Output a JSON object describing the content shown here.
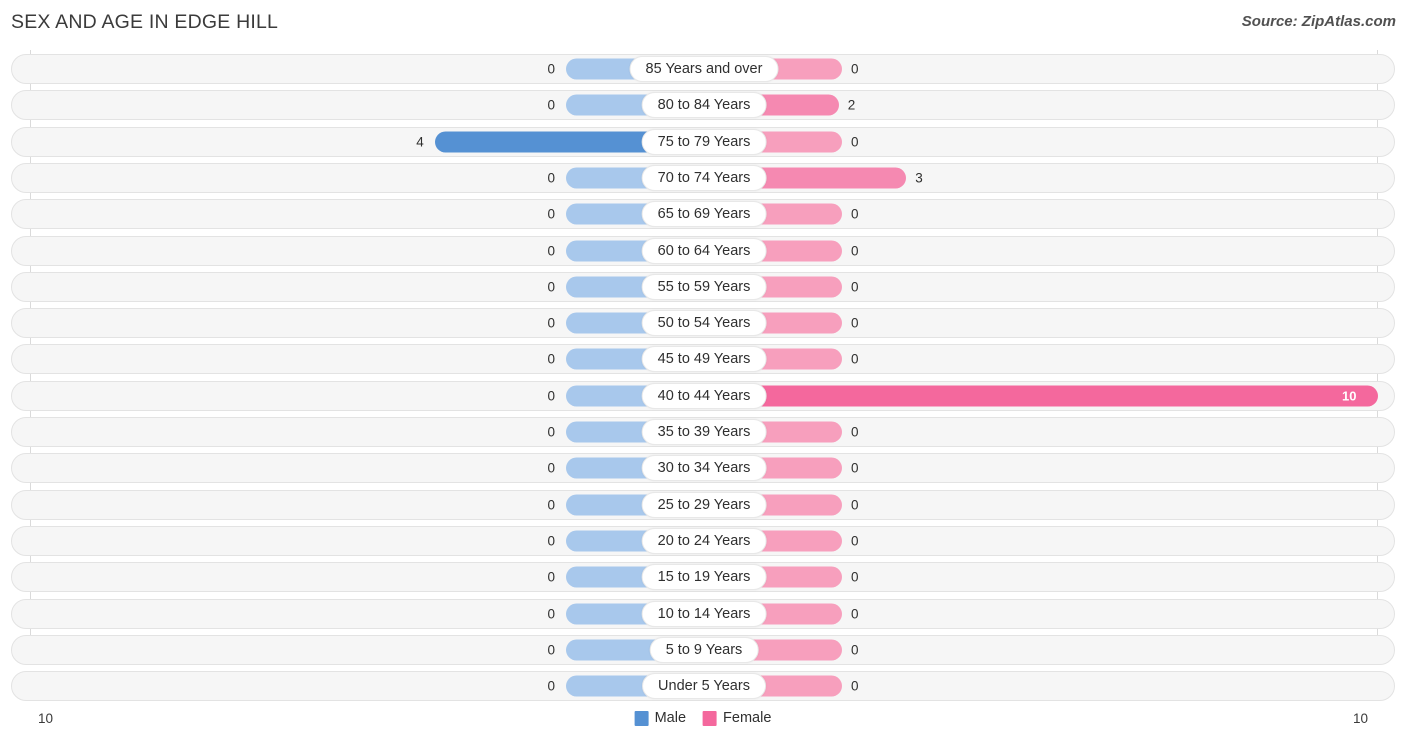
{
  "header": {
    "title": "SEX AND AGE IN EDGE HILL",
    "source": "Source: ZipAtlas.com"
  },
  "legend": {
    "male_label": "Male",
    "female_label": "Female",
    "male_color": "#5591d3",
    "female_color": "#f4689d"
  },
  "axis": {
    "left_tick": "10",
    "right_tick": "10",
    "max": 10
  },
  "chart_data": {
    "type": "bar",
    "title": "SEX AND AGE IN EDGE HILL",
    "subtitle": "Source: ZipAtlas.com",
    "orientation": "horizontal-diverging",
    "xlabel": "",
    "ylabel": "",
    "xlim": [
      -10,
      10
    ],
    "grid": false,
    "legend_position": "bottom-center",
    "categories": [
      "85 Years and over",
      "80 to 84 Years",
      "75 to 79 Years",
      "70 to 74 Years",
      "65 to 69 Years",
      "60 to 64 Years",
      "55 to 59 Years",
      "50 to 54 Years",
      "45 to 49 Years",
      "40 to 44 Years",
      "35 to 39 Years",
      "30 to 34 Years",
      "25 to 29 Years",
      "20 to 24 Years",
      "15 to 19 Years",
      "10 to 14 Years",
      "5 to 9 Years",
      "Under 5 Years"
    ],
    "series": [
      {
        "name": "Male",
        "color": "#5591d3",
        "values": [
          0,
          0,
          4,
          0,
          0,
          0,
          0,
          0,
          0,
          0,
          0,
          0,
          0,
          0,
          0,
          0,
          0,
          0
        ]
      },
      {
        "name": "Female",
        "color": "#f4689d",
        "values": [
          0,
          2,
          0,
          3,
          0,
          0,
          0,
          0,
          0,
          10,
          0,
          0,
          0,
          0,
          0,
          0,
          0,
          0
        ]
      }
    ]
  },
  "rows": [
    {
      "label": "85 Years and over",
      "male": "0",
      "female": "0"
    },
    {
      "label": "80 to 84 Years",
      "male": "0",
      "female": "2"
    },
    {
      "label": "75 to 79 Years",
      "male": "4",
      "female": "0"
    },
    {
      "label": "70 to 74 Years",
      "male": "0",
      "female": "3"
    },
    {
      "label": "65 to 69 Years",
      "male": "0",
      "female": "0"
    },
    {
      "label": "60 to 64 Years",
      "male": "0",
      "female": "0"
    },
    {
      "label": "55 to 59 Years",
      "male": "0",
      "female": "0"
    },
    {
      "label": "50 to 54 Years",
      "male": "0",
      "female": "0"
    },
    {
      "label": "45 to 49 Years",
      "male": "0",
      "female": "0"
    },
    {
      "label": "40 to 44 Years",
      "male": "0",
      "female": "10"
    },
    {
      "label": "35 to 39 Years",
      "male": "0",
      "female": "0"
    },
    {
      "label": "30 to 34 Years",
      "male": "0",
      "female": "0"
    },
    {
      "label": "25 to 29 Years",
      "male": "0",
      "female": "0"
    },
    {
      "label": "20 to 24 Years",
      "male": "0",
      "female": "0"
    },
    {
      "label": "15 to 19 Years",
      "male": "0",
      "female": "0"
    },
    {
      "label": "10 to 14 Years",
      "male": "0",
      "female": "0"
    },
    {
      "label": "5 to 9 Years",
      "male": "0",
      "female": "0"
    },
    {
      "label": "Under 5 Years",
      "male": "0",
      "female": "0"
    }
  ]
}
